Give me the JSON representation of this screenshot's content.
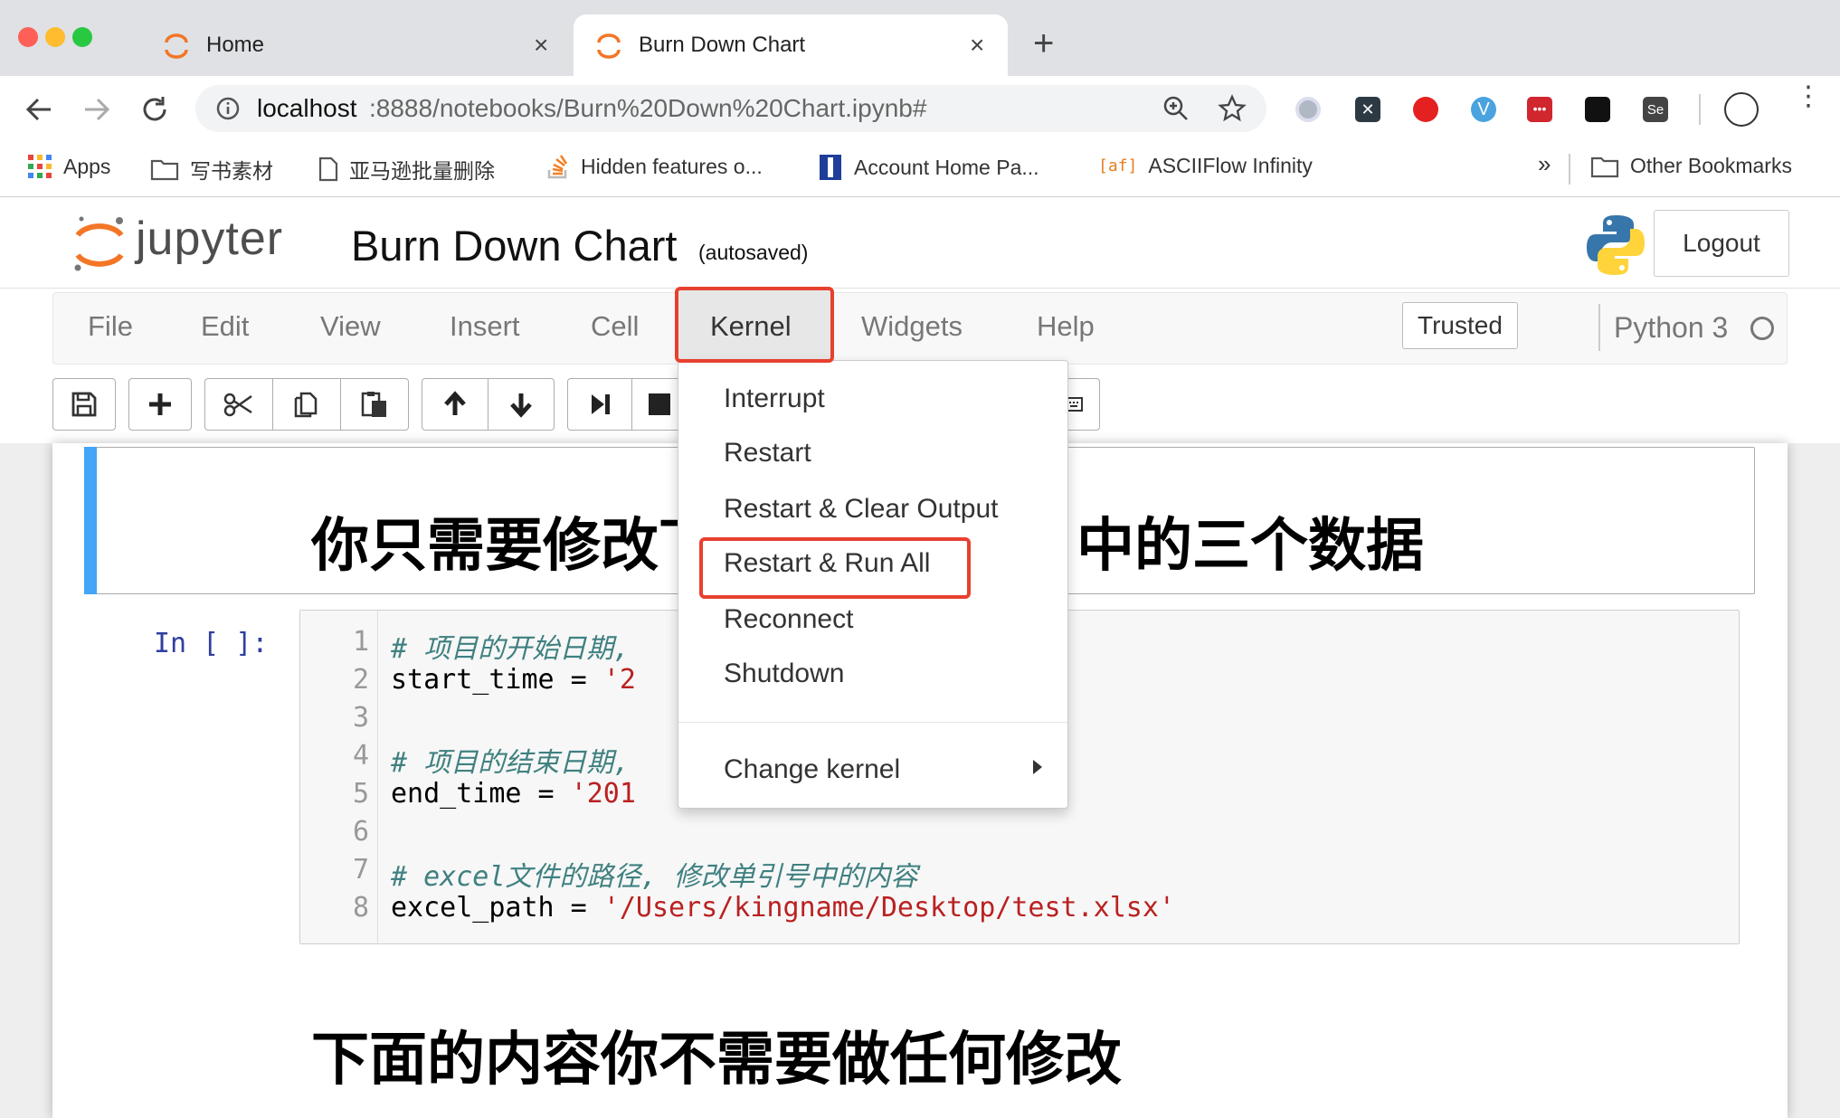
{
  "browser": {
    "tabs": [
      {
        "title": "Home",
        "active": false
      },
      {
        "title": "Burn Down Chart",
        "active": true
      }
    ],
    "url_host": "localhost",
    "url_rest": ":8888/notebooks/Burn%20Down%20Chart.ipynb#",
    "bookmarks": [
      "Apps",
      "写书素材",
      "亚马逊批量删除",
      "Hidden features o...",
      "Account Home Pa...",
      "ASCIIFlow Infinity"
    ],
    "bookmarks_more": "»",
    "other_bookmarks": "Other Bookmarks",
    "asciiflow_badge": "[af]"
  },
  "jupyter": {
    "logo_text": "jupyter",
    "notebook_title": "Burn Down Chart",
    "autosave_status": "(autosaved)",
    "logout_label": "Logout",
    "menus": [
      "File",
      "Edit",
      "View",
      "Insert",
      "Cell",
      "Kernel",
      "Widgets",
      "Help"
    ],
    "trusted_label": "Trusted",
    "kernel_name": "Python 3"
  },
  "kernel_menu": {
    "items": [
      "Interrupt",
      "Restart",
      "Restart & Clear Output",
      "Restart & Run All",
      "Reconnect",
      "Shutdown"
    ],
    "submenu_item": "Change kernel",
    "highlighted": "Restart & Run All"
  },
  "cells": {
    "markdown_heading": "你只需要修改下面代码中的三个数据",
    "markdown_visible_left": "你只需要修改下",
    "markdown_visible_right": "中的三个数据",
    "prompt": "In [ ]:",
    "line_numbers": [
      "1",
      "2",
      "3",
      "4",
      "5",
      "6",
      "7",
      "8"
    ],
    "code_lines": [
      {
        "comment": "# 项目的开始日期,"
      },
      {
        "code": "start_time = ",
        "string": "'2"
      },
      {},
      {
        "comment": "# 项目的结束日期,"
      },
      {
        "code": "end_time = ",
        "string": "'201"
      },
      {},
      {
        "comment": "# excel文件的路径, 修改单引号中的内容"
      },
      {
        "code": "excel_path = ",
        "string": "'/Users/kingname/Desktop/test.xlsx'"
      }
    ],
    "bottom_heading": "下面的内容你不需要做任何修改"
  },
  "colors": {
    "highlight_red": "#e8402f",
    "cell_selected_bar": "#42a5f5",
    "jupyter_orange": "#f37626"
  }
}
